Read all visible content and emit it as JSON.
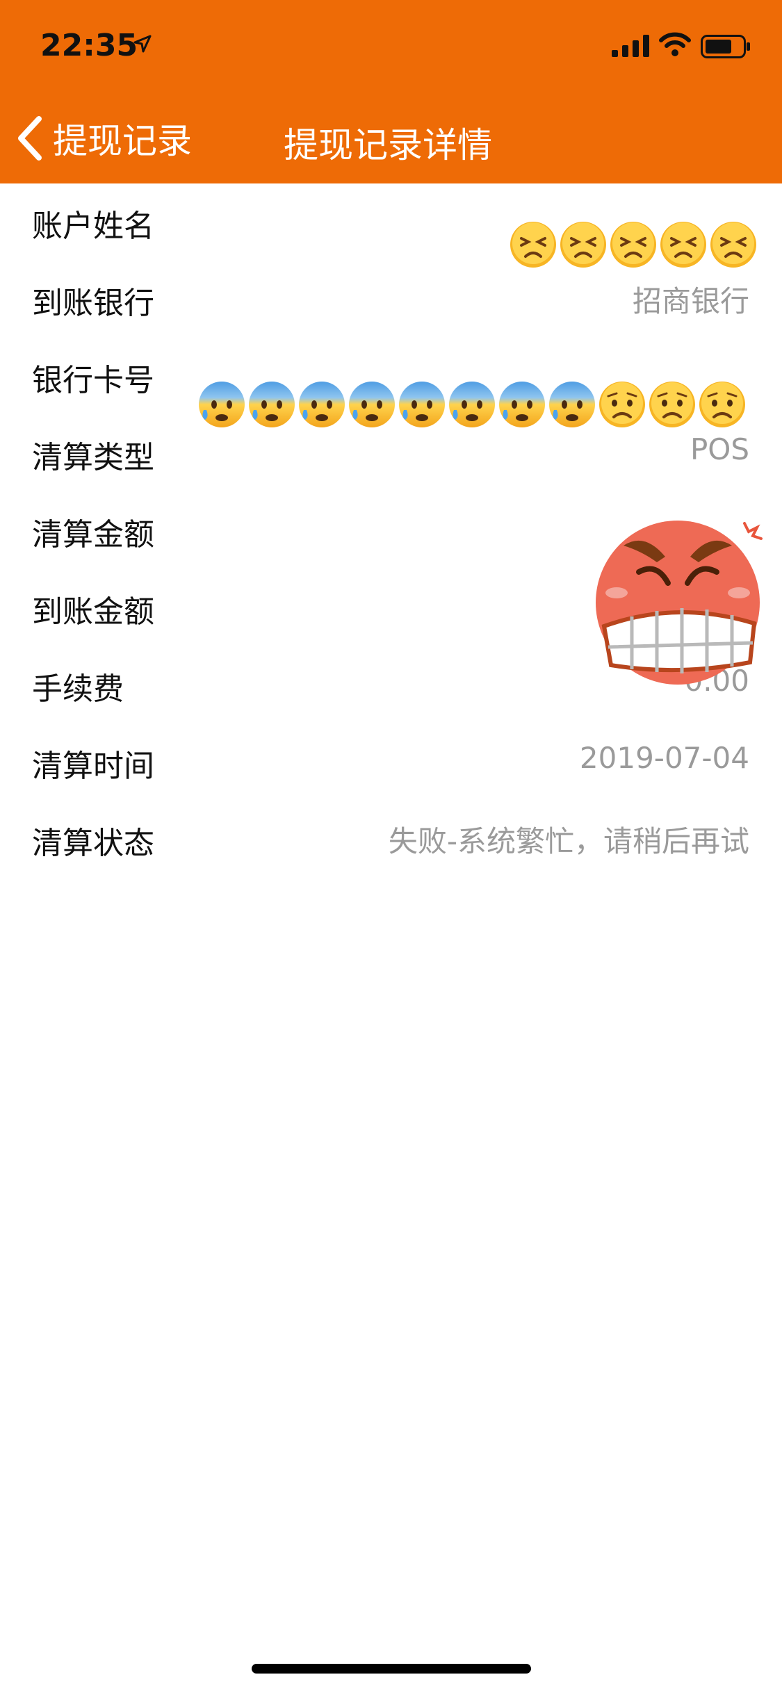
{
  "status_bar": {
    "time": "22:35"
  },
  "nav": {
    "back_label": "提现记录",
    "title": "提现记录详情"
  },
  "rows": [
    {
      "label": "账户姓名",
      "value": ""
    },
    {
      "label": "到账银行",
      "value": "招商银行"
    },
    {
      "label": "银行卡号",
      "value": ""
    },
    {
      "label": "清算类型",
      "value": "POS"
    },
    {
      "label": "清算金额",
      "value": ""
    },
    {
      "label": "到账金额",
      "value": ""
    },
    {
      "label": "手续费",
      "value": "0.00"
    },
    {
      "label": "清算时间",
      "value": "2019-07-04"
    },
    {
      "label": "清算状态",
      "value": "失败-系统繁忙，请稍后再试"
    }
  ],
  "colors": {
    "header": "#ee6b06",
    "value_text": "#9a9a9a",
    "label_text": "#111111"
  },
  "overlay_emojis": [
    "persevering-face",
    "anxious-face-with-sweat",
    "worried-face",
    "angry-grimace-sticker"
  ]
}
